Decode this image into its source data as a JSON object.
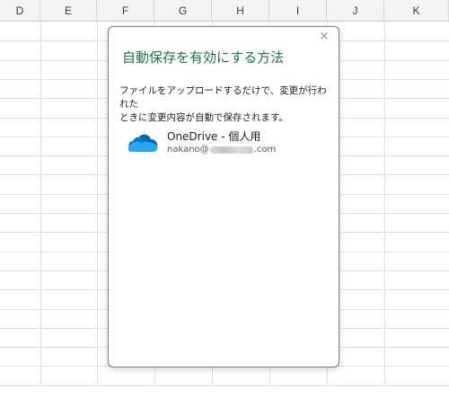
{
  "spreadsheet": {
    "columns": [
      "D",
      "E",
      "F",
      "G",
      "H",
      "I",
      "J",
      "K"
    ]
  },
  "dialog": {
    "close_glyph": "×",
    "title": "自動保存を有効にする方法",
    "description_line1": "ファイルをアップロードするだけで、変更が行われた",
    "description_line2": "ときに変更内容が自動で保存されます。",
    "account": {
      "name": "OneDrive - 個人用",
      "email_prefix": "nakano@",
      "email_suffix": ".com",
      "icon": "onedrive-cloud-icon"
    }
  },
  "colors": {
    "title": "#217346",
    "onedrive_blue_dark": "#0364b8",
    "onedrive_blue_mid": "#0078d4",
    "onedrive_blue_light": "#28a8ea"
  }
}
